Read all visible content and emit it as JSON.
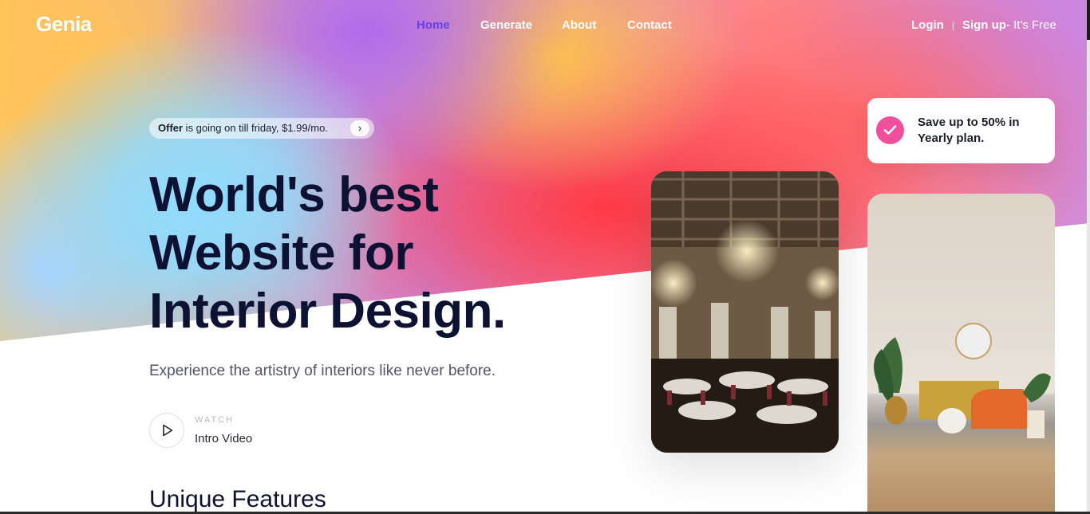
{
  "brand": {
    "name": "Genia"
  },
  "nav": {
    "items": [
      {
        "label": "Home",
        "active": true
      },
      {
        "label": "Generate",
        "active": false
      },
      {
        "label": "About",
        "active": false
      },
      {
        "label": "Contact",
        "active": false
      }
    ]
  },
  "auth": {
    "login": "Login",
    "separator": "|",
    "signup": "Sign up",
    "free": "- It's Free"
  },
  "offer": {
    "bold": "Offer",
    "text": " is going on till friday, $1.99/mo.",
    "arrow_icon": "chevron-right-icon"
  },
  "hero": {
    "line1": "World's best",
    "line2": "Website for",
    "line3": "Interior Design.",
    "subtitle": "Experience the artistry of interiors like never before."
  },
  "video": {
    "small": "WATCH",
    "label": "Intro Video",
    "icon": "play-icon"
  },
  "features": {
    "title": "Unique Features"
  },
  "save_card": {
    "text": "Save up to 50% in Yearly plan.",
    "icon": "check-icon"
  },
  "colors": {
    "accent": "#6a3ee8",
    "headline": "#0d1233",
    "check_badge": "#f0509b"
  }
}
